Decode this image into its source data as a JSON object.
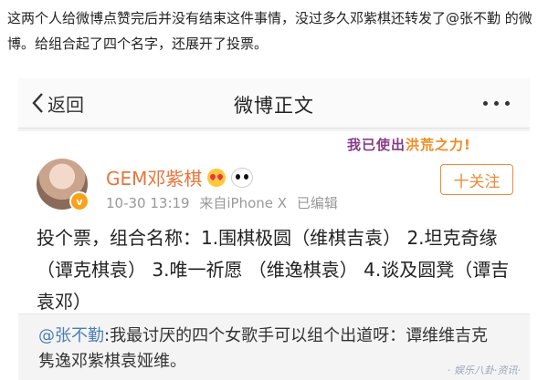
{
  "article": {
    "paragraph": "这两个人给微博点赞完后并没有结束这件事情，没过多久邓紫棋还转发了@张不勤 的微博。给组合起了四个名字，还展开了投票。"
  },
  "nav": {
    "back_label": "返回",
    "title": "微博正文"
  },
  "post": {
    "username": "GEM邓紫棋",
    "time": "10-30 13:19",
    "source": "来自iPhone X",
    "edited": "已编辑",
    "follow_label": "十关注",
    "sticker_text": "我已使出",
    "sticker_highlight": "洪荒之力!",
    "body": "投个票，组合名称：1.围棋极圆（维棋吉袁） 2.坦克奇缘（谭克棋袁） 3.唯一祈愿 （维逸棋袁） 4.谈及圆凳（谭吉袁邓）"
  },
  "repost": {
    "mention": "@张不勤",
    "text": ":我最讨厌的四个女歌手可以组个出道呀：谭维维吉克隽逸邓紫棋袁娅维。"
  },
  "watermark": "· 娱乐八卦·资讯·"
}
